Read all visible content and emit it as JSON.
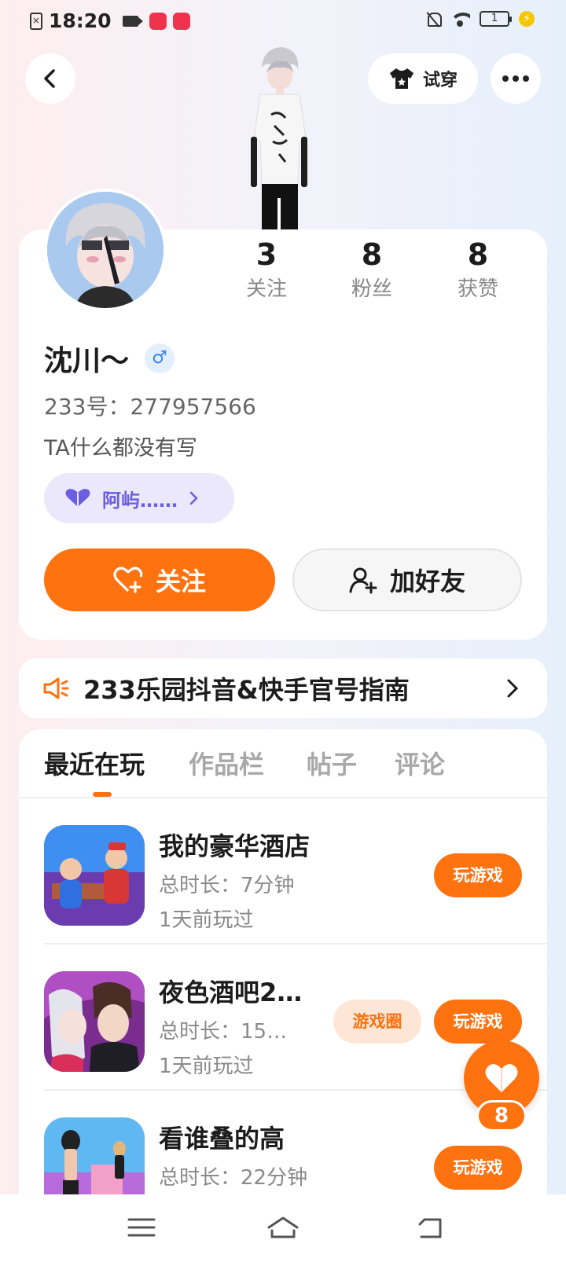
{
  "status_bar": {
    "time": "18:20",
    "battery": "1"
  },
  "header": {
    "tryon_label": "试穿"
  },
  "profile": {
    "stats": [
      {
        "value": "3",
        "label": "关注"
      },
      {
        "value": "8",
        "label": "粉丝"
      },
      {
        "value": "8",
        "label": "获赞"
      }
    ],
    "username": "沈川～",
    "gender_symbol": "♂",
    "uid": "233号：277957566",
    "bio": "TA什么都没有写",
    "tag_label": "阿屿……",
    "follow_label": "关注",
    "add_friend_label": "加好友"
  },
  "banner": {
    "text": "233乐园抖音&快手官号指南"
  },
  "tabs": [
    {
      "label": "最近在玩",
      "active": true
    },
    {
      "label": "作品栏",
      "active": false
    },
    {
      "label": "帖子",
      "active": false
    },
    {
      "label": "评论",
      "active": false
    }
  ],
  "games": [
    {
      "name": "我的豪华酒店",
      "duration": "总时长：7分钟",
      "last_played": "1天前玩过",
      "play_label": "玩游戏"
    },
    {
      "name": "夜色酒吧2…",
      "duration": "总时长：15…",
      "last_played": "1天前玩过",
      "circle_label": "游戏圈",
      "play_label": "玩游戏"
    },
    {
      "name": "看谁叠的高",
      "duration": "总时长：22分钟",
      "play_label": "玩游戏"
    }
  ],
  "float_like": {
    "count": "8"
  },
  "colors": {
    "accent": "#ff7210",
    "tag_purple": "#6b5ee0"
  }
}
